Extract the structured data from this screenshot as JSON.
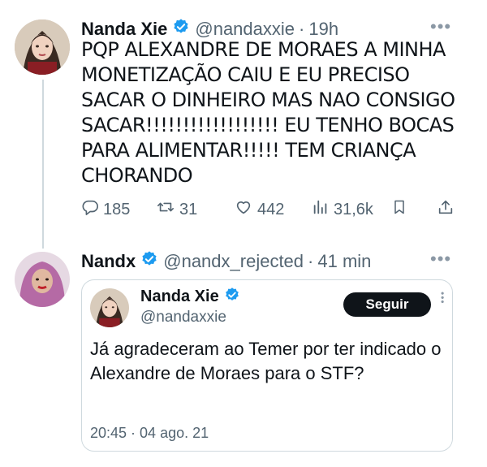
{
  "tweet": {
    "author_name": "Nanda Xie",
    "author_handle": "@nandaxxie",
    "separator": "·",
    "time": "19h",
    "text": "PQP ALEXANDRE DE MORAES A MINHA MONETIZAÇÃO CAIU E EU PRECISO SACAR O DINHEIRO MAS NAO CONSIGO SACAR!!!!!!!!!!!!!!!!!! EU TENHO BOCAS PARA ALIMENTAR!!!!! TEM CRIANÇA CHORANDO",
    "replies": "185",
    "retweets": "31",
    "likes": "442",
    "views": "31,6k"
  },
  "reply": {
    "author_name": "Nandx",
    "author_handle": "@nandx_rejected",
    "separator": "·",
    "time": "41 min"
  },
  "quoted_card": {
    "author_name": "Nanda Xie",
    "author_handle": "@nandaxxie",
    "follow_label": "Seguir",
    "text": "Já agradeceram ao Temer por ter indicado o Alexandre de Moraes para o STF?",
    "timestamp": "20:45 · 04 ago. 21"
  },
  "colors": {
    "verified": "#1d9bf0",
    "muted": "#536471",
    "border": "#cfd9de"
  },
  "icons": [
    "verified-badge-icon",
    "more-icon",
    "reply-icon",
    "retweet-icon",
    "like-icon",
    "views-icon",
    "bookmark-icon",
    "share-icon"
  ]
}
